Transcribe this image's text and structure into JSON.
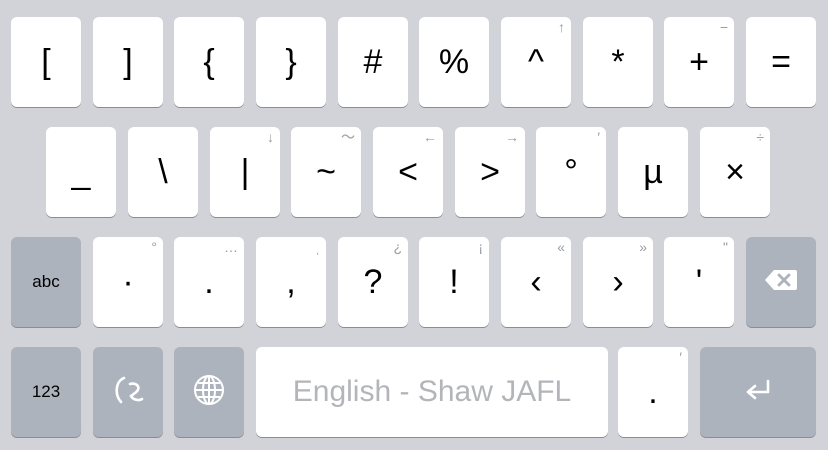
{
  "keyboard": {
    "row1": [
      {
        "main": "[",
        "sub": ""
      },
      {
        "main": "]",
        "sub": ""
      },
      {
        "main": "{",
        "sub": ""
      },
      {
        "main": "}",
        "sub": ""
      },
      {
        "main": "#",
        "sub": ""
      },
      {
        "main": "%",
        "sub": ""
      },
      {
        "main": "^",
        "sub": "↑"
      },
      {
        "main": "*",
        "sub": ""
      },
      {
        "main": "+",
        "sub": "−"
      },
      {
        "main": "=",
        "sub": ""
      }
    ],
    "row2": [
      {
        "main": "_",
        "sub": ""
      },
      {
        "main": "\\",
        "sub": ""
      },
      {
        "main": "|",
        "sub": "↓"
      },
      {
        "main": "~",
        "sub": "〜"
      },
      {
        "main": "<",
        "sub": "←"
      },
      {
        "main": ">",
        "sub": "→"
      },
      {
        "main": "°",
        "sub": "′"
      },
      {
        "main": "µ",
        "sub": ""
      },
      {
        "main": "×",
        "sub": "÷"
      }
    ],
    "row3": {
      "abc_label": "abc",
      "keys": [
        {
          "main": "·",
          "sub": "°"
        },
        {
          "main": ".",
          "sub": "…"
        },
        {
          "main": ",",
          "sub": "ˌ"
        },
        {
          "main": "?",
          "sub": "¿"
        },
        {
          "main": "!",
          "sub": "¡"
        },
        {
          "main": "‹",
          "sub": "«"
        },
        {
          "main": "›",
          "sub": "»"
        },
        {
          "main": "'",
          "sub": "\""
        }
      ],
      "delete_icon": "delete-icon"
    },
    "row4": {
      "numbers_label": "123",
      "shavian_icon": "shavian-switch-icon",
      "globe_icon": "globe-icon",
      "space_label": "English - Shaw JAFL",
      "period": {
        "main": ".",
        "sub": "′"
      },
      "return_icon": "return-icon"
    },
    "colors": {
      "background": "#d1d3d9",
      "key": "#ffffff",
      "special_key": "#adb3bd",
      "secondary_text": "#9a9ca2"
    }
  }
}
